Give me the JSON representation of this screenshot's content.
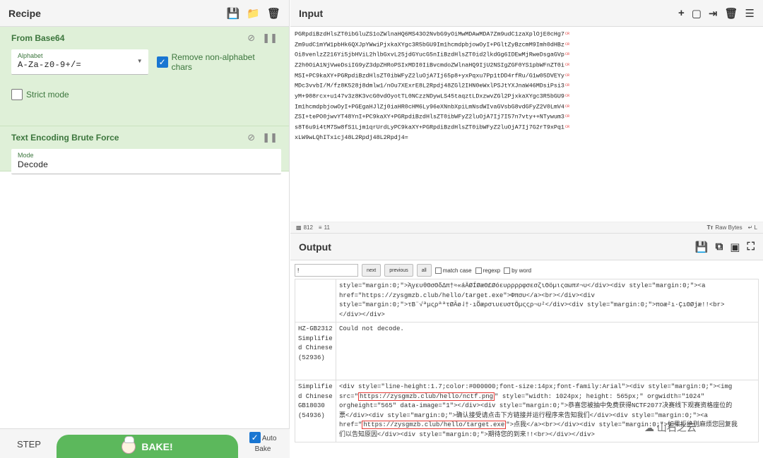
{
  "recipe": {
    "title": "Recipe",
    "operations": [
      {
        "name": "From Base64",
        "alphabet_label": "Alphabet",
        "alphabet_value": "A-Za-z0-9+/=",
        "remove_nonalpha_label": "Remove non-alphabet chars",
        "strict_mode_label": "Strict mode"
      },
      {
        "name": "Text Encoding Brute Force",
        "mode_label": "Mode",
        "mode_value": "Decode"
      }
    ],
    "step_label": "STEP",
    "bake_label": "BAKE!",
    "autobake_label": "Auto Bake"
  },
  "input": {
    "title": "Input",
    "lines": [
      "PGRpdiBzdHlsZT0ibGluZS1oZWlnaHQ6MS43O2NvbG9yOiMwMDAwMDA7Zm9udC1zaXplOjE0cHg7",
      "Zm9udC1mYW1pbHk6QXJpYWwiPjxkaXYgc3R5bGU9Im1hcmdpbjowOyI+PGltZyBzcmM9Imh0dHBz",
      "Oi8venlzZ216Yi5jbHViL2hlbGxvL25jdGYucG5nIiBzdHlsZT0id2lkdGg6IDEwMjRweDsgaGVp",
      "Z2h0OiA1NjVweDsiIG9yZ3dpZHRoPSIxMDI0IiBvcmdoZWlnaHQ9IjU2NSIgZGF0YS1pbWFnZT0i",
      "MSI+PC9kaXY+PGRpdiBzdHlsZT0ibWFyZ2luOjA7Ij65p8+yxPqxu7Pp1tDD4rfRu/G1w05DVEYy",
      "MDc3vvbI/M/fz8K528j8dmlw1/nOu7XExrE8L2Rpdj48ZGl2IHN0eWxlPSJtYXJnaW46MDsiPsi3",
      "yM+908rcx+u147v3z8K3vcG0vdOyotTL0NCzzNDywLS45taqztLDxzwvZGl2PjxkaXYgc3R5bGU9",
      "Im1hcmdpbjowOyI+PGEgaHJlZj0iaHR0cHM6Ly96eXNnbXpiLmNsdWIvaGVsbG8vdGFyZ2V0LmV4",
      "ZSI+tePO0jwvYT48YnI+PC9kaXY+PGRpdiBzdHlsZT0ibWFyZ2luOjA7Ij7I57n7vty++NTywum3",
      "s8T6u9i4tM7Sw8fS1Ljm1qrUrdLyPC9kaXY+PGRpdiBzdHlsZT0ibWFyZ2luOjA7Ij7G2rT9xPq1",
      "xLW9wLQhITxicj48L2Rpdj48L2Rpdj4="
    ],
    "char_count": "812",
    "line_count": "11",
    "format_label": "Raw Bytes"
  },
  "output": {
    "title": "Output",
    "search_value": "!",
    "next_label": "next",
    "previous_label": "previous",
    "all_label": "all",
    "match_case_label": "match case",
    "regexp_label": "regexp",
    "by_word_label": "by word",
    "rows": [
      {
        "encoding": "",
        "text_a": "style=\"margin:0;\">Ὰ̨γευθΘσΘδΔπ†≈«áÄØÍØæΘ£Øóευρρρρφσεσζιʘöµɩςαωπ≠¬υ</div><div style=\"margin:0;\"><a",
        "text_b": "href=\"https://zysgmzb.club/hello/target.exe\">Φπσυ</a><br></div><div",
        "text_c": "style=\"margin:0;\">τΒ¨√ªμςρªªτØĀø˨†·ıÕæρσιυευστÖµςςρ¬υ²</div><div style=\"margin:0;\">ποæ²ı·ÇıΘØjæ!!<br>",
        "text_d": "</div></div>"
      },
      {
        "encoding": "HZ-GB2312 Simplified Chinese (52936)",
        "text_a": "Could not decode."
      },
      {
        "encoding": "Simplified Chinese GB18030 (54936)",
        "text_a": "<div style=\"line-height:1.7;color:#000000;font-size:14px;font-family:Arial\"><div style=\"margin:0;\"><img",
        "text_b_pre": "src=\"",
        "url_png": "https://zysgmzb.club/hello/nctf.png",
        "text_b_post": "\" style=\"width: 1024px; height: 565px;\" orgwidth=\"1024\"",
        "text_c": "orgheight=\"565\" data-image=\"1\"></div><div style=\"margin:0;\">恭喜您被抽中免费获得NCTF2077决赛线下观赛资格座位的",
        "text_d": "票</div><div style=\"margin:0;\">确认接受请点击下方链接并运行程序来告知我们</div><div style=\"margin:0;\"><a",
        "text_e_pre": "href=\"",
        "url_exe": "https://zysgmzb.club/hello/target.exe",
        "text_e_post": "\">点我</a><br></div><div style=\"margin:0;\">如果拒绝则麻烦您回复我",
        "text_f": "们以告知原因</div><div style=\"margin:0;\">期待您的到来!!<br></div></div>"
      }
    ]
  },
  "watermark_text": "山石之云"
}
